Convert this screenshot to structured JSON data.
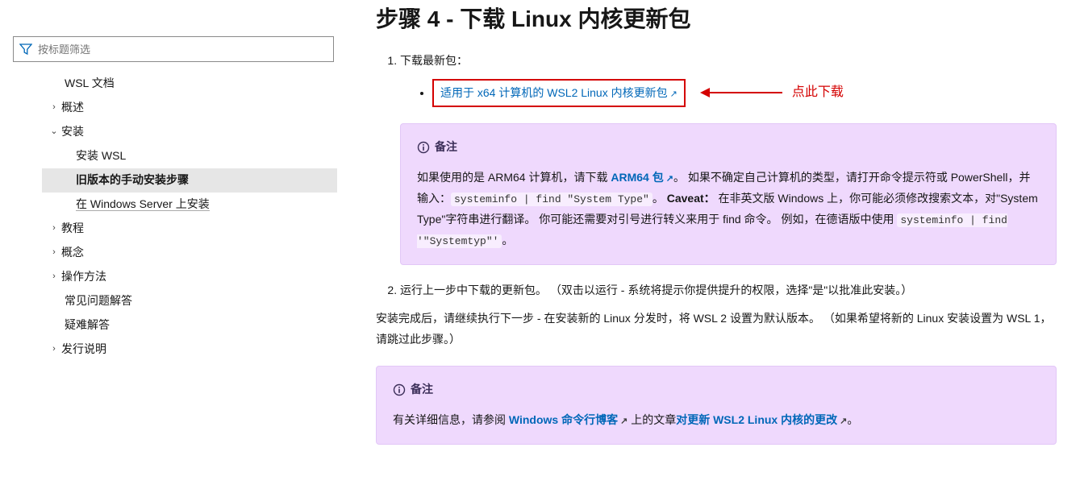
{
  "sidebar": {
    "filter_placeholder": "按标题筛选",
    "items": [
      {
        "label": "WSL 文档",
        "chev": "",
        "indent": 1
      },
      {
        "label": "概述",
        "chev": ">",
        "indent": 0
      },
      {
        "label": "安装",
        "chev": "v",
        "indent": 0
      },
      {
        "label": "安装 WSL",
        "chev": "",
        "indent": 2
      },
      {
        "label": "旧版本的手动安装步骤",
        "chev": "",
        "indent": 2,
        "active": true
      },
      {
        "label": "在 Windows Server 上安装",
        "chev": "",
        "indent": 2,
        "underline": true
      },
      {
        "label": "教程",
        "chev": ">",
        "indent": 0
      },
      {
        "label": "概念",
        "chev": ">",
        "indent": 0
      },
      {
        "label": "操作方法",
        "chev": ">",
        "indent": 0
      },
      {
        "label": "常见问题解答",
        "chev": "",
        "indent": 1
      },
      {
        "label": "疑难解答",
        "chev": "",
        "indent": 1
      },
      {
        "label": "发行说明",
        "chev": ">",
        "indent": 0
      }
    ]
  },
  "main": {
    "heading": "步骤 4 - 下载 Linux 内核更新包",
    "step1_prefix": "下载最新包：",
    "boxed_link": "适用于 x64 计算机的 WSL2 Linux 内核更新包",
    "annotation": "点此下载",
    "note1_title": "备注",
    "note1_pt_a": "如果使用的是 ARM64 计算机，请下载 ",
    "note1_link1": "ARM64 包",
    "note1_pt_b": "。 如果不确定自己计算机的类型，请打开命令提示符或 PowerShell，并输入：",
    "note1_code1": "systeminfo | find \"System Type\"",
    "note1_pt_c": "。 ",
    "note1_caveat": "Caveat：",
    "note1_pt_d": " 在非英文版 Windows 上，你可能必须修改搜索文本，对\"System Type\"字符串进行翻译。 你可能还需要对引号进行转义来用于 find 命令。 例如，在德语版中使用 ",
    "note1_code2": "systeminfo | find '\"Systemtyp\"'",
    "note1_pt_e": "。",
    "step2": "运行上一步中下载的更新包。 （双击以运行 - 系统将提示你提供提升的权限，选择\"是\"以批准此安装。）",
    "para_after": "安装完成后，请继续执行下一步 - 在安装新的 Linux 分发时，将 WSL 2 设置为默认版本。 （如果希望将新的 Linux 安装设置为 WSL 1，请跳过此步骤。）",
    "note2_title": "备注",
    "note2_pt_a": "有关详细信息，请参阅 ",
    "note2_link1": "Windows 命令行博客",
    "note2_pt_b": " 上的文章",
    "note2_link2": "对更新 WSL2 Linux 内核的更改",
    "note2_pt_c": "。"
  }
}
